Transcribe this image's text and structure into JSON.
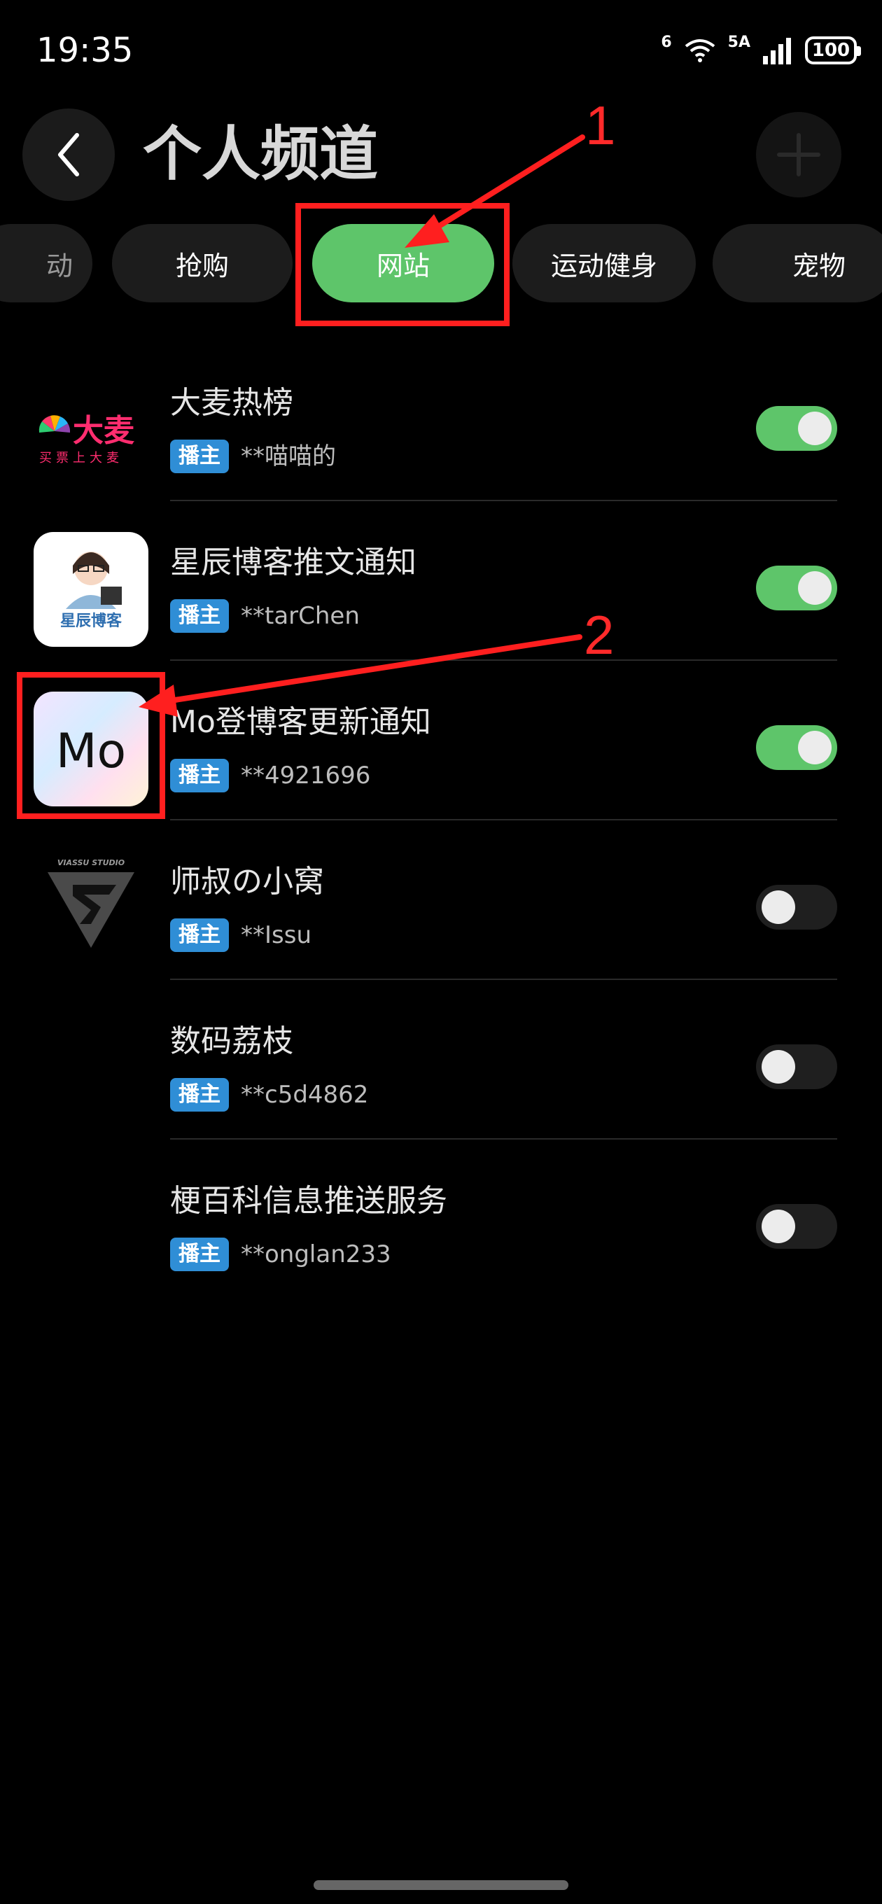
{
  "status_bar": {
    "time": "19:35",
    "network_a": "6",
    "network_b": "5A",
    "battery": "100"
  },
  "header": {
    "title": "个人频道"
  },
  "tabs": [
    {
      "label": "动",
      "active": false
    },
    {
      "label": "抢购",
      "active": false
    },
    {
      "label": "网站",
      "active": true
    },
    {
      "label": "运动健身",
      "active": false
    },
    {
      "label": "宠物",
      "active": false
    }
  ],
  "annotations": {
    "marker_1": "1",
    "marker_2": "2",
    "color": "#ff1f1f"
  },
  "channels": [
    {
      "name": "大麦热榜",
      "badge": "播主",
      "owner": "**喵喵的",
      "enabled": true,
      "icon": "damai-logo-icon",
      "icon_text_main": "大麦",
      "icon_text_sub": "买票上大麦"
    },
    {
      "name": "星辰博客推文通知",
      "badge": "播主",
      "owner": "**tarChen",
      "enabled": true,
      "icon": "xingchen-blog-icon",
      "icon_text_main": "星辰博客"
    },
    {
      "name": "Mo登博客更新通知",
      "badge": "播主",
      "owner": "**4921696",
      "enabled": true,
      "icon": "mo-blog-icon",
      "icon_text_main": "Mo"
    },
    {
      "name": "师叔の小窝",
      "badge": "播主",
      "owner": "**Issu",
      "enabled": false,
      "icon": "viassu-studio-icon",
      "icon_text_main": "VIASSU STUDIO"
    },
    {
      "name": "数码荔枝",
      "badge": "播主",
      "owner": "**c5d4862",
      "enabled": false,
      "icon": "none"
    },
    {
      "name": "梗百科信息推送服务",
      "badge": "播主",
      "owner": "**onglan233",
      "enabled": false,
      "icon": "none"
    }
  ],
  "colors": {
    "accent": "#5ec56a",
    "badge": "#2f8ed6",
    "background": "#000000"
  }
}
